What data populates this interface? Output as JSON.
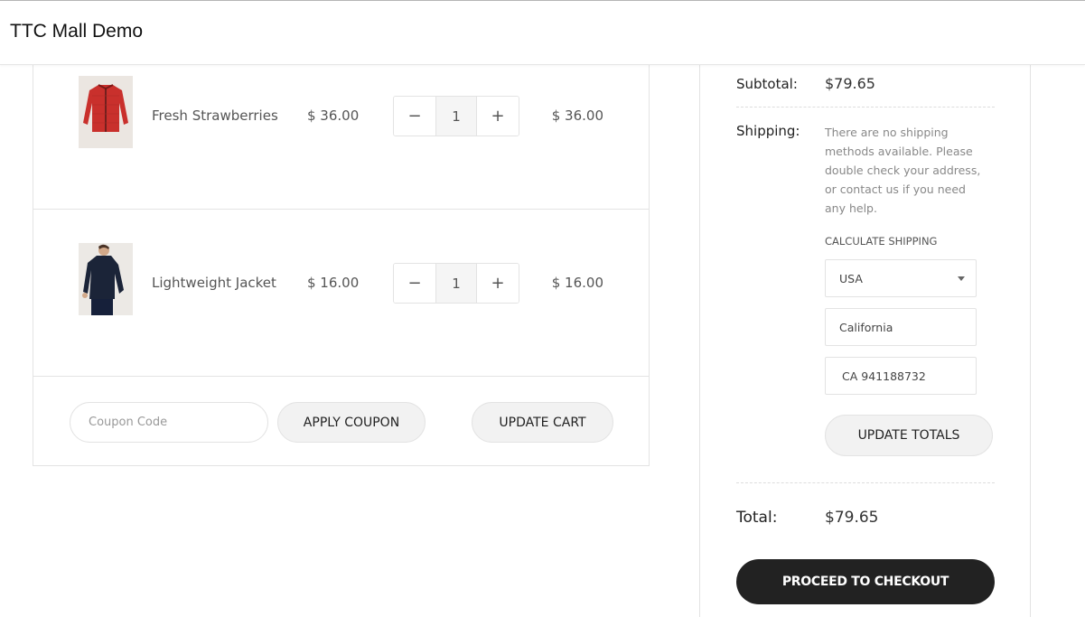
{
  "app": {
    "title": "TTC Mall Demo"
  },
  "cart": {
    "items": [
      {
        "name": "Fresh Strawberries",
        "price": "$ 36.00",
        "quantity": "1",
        "line_total": "$ 36.00",
        "image": "red-jacket"
      },
      {
        "name": "Lightweight Jacket",
        "price": "$ 16.00",
        "quantity": "1",
        "line_total": "$ 16.00",
        "image": "navy-jacket"
      }
    ],
    "qty_minus": "−",
    "qty_plus": "+",
    "coupon": {
      "placeholder": "Coupon Code",
      "value": ""
    },
    "apply_coupon_label": "APPLY COUPON",
    "update_cart_label": "UPDATE CART"
  },
  "totals": {
    "subtotal_label": "Subtotal:",
    "subtotal_value": "$79.65",
    "shipping_label": "Shipping:",
    "shipping_message": "There are no shipping methods available. Please double check your address, or contact us if you need any help.",
    "calculate_shipping_label": "CALCULATE SHIPPING",
    "country": "USA",
    "state": "California",
    "zip": "CA 941188732",
    "update_totals_label": "UPDATE TOTALS",
    "total_label": "Total:",
    "total_value": "$79.65",
    "checkout_label": "PROCEED TO CHECKOUT"
  }
}
